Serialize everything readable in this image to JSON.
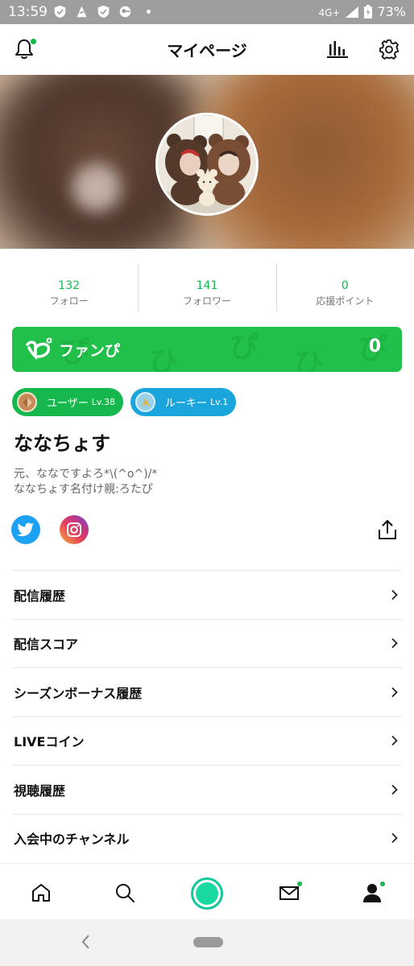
{
  "status_bar": {
    "time": "13:59",
    "network": "4G+",
    "battery": "73%",
    "icons": [
      "shield-check-icon",
      "notification-app-icon",
      "shield-check-icon",
      "vpn-key-icon"
    ]
  },
  "header": {
    "title": "マイページ",
    "left_icon": "bell-icon",
    "right_icons": [
      "ranking-bars-icon",
      "gear-icon"
    ]
  },
  "stats": [
    {
      "value": "132",
      "label": "フォロー"
    },
    {
      "value": "141",
      "label": "フォロワー"
    },
    {
      "value": "0",
      "label": "応援ポイント"
    }
  ],
  "fan": {
    "label": "ファンぴ",
    "value": "0",
    "color": "#20c04a"
  },
  "badges": {
    "user": {
      "text": "ユーザー",
      "level": "Lv.38",
      "color": "#16b84e"
    },
    "rookie": {
      "text": "ルーキー",
      "level": "Lv.1",
      "color": "#1aa5dc"
    }
  },
  "profile": {
    "name": "ななちょす",
    "bio_line1": "元、ななですよろ*\\(^o^)/*",
    "bio_line2": "ななちょす名付け親:ろたぴ"
  },
  "sns": [
    "twitter-icon",
    "instagram-icon"
  ],
  "menu": [
    {
      "label": "配信履歴"
    },
    {
      "label": "配信スコア"
    },
    {
      "label": "シーズンボーナス履歴"
    },
    {
      "label": "LIVEコイン"
    },
    {
      "label": "視聴履歴"
    },
    {
      "label": "入会中のチャンネル"
    }
  ],
  "bottom_nav": [
    "home-icon",
    "search-icon",
    "live-broadcast-button",
    "mail-icon",
    "profile-icon"
  ],
  "accent_color": "#16b84e"
}
